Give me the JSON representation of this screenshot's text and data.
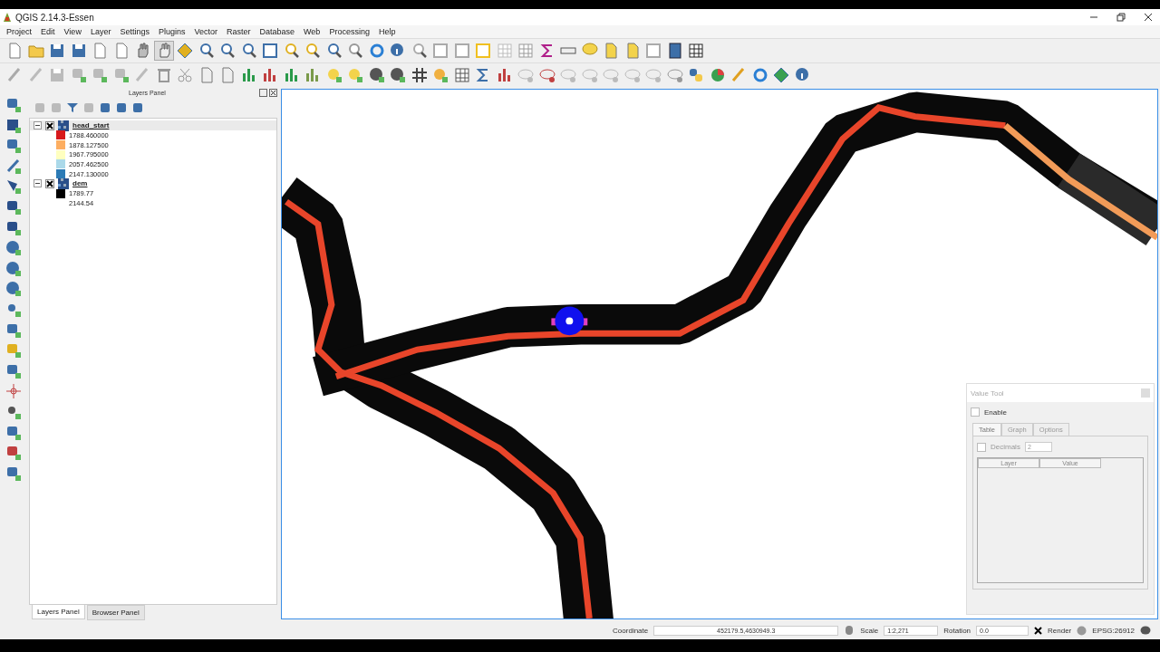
{
  "window": {
    "title": "QGIS 2.14.3-Essen"
  },
  "menu": [
    "Project",
    "Edit",
    "View",
    "Layer",
    "Settings",
    "Plugins",
    "Vector",
    "Raster",
    "Database",
    "Web",
    "Processing",
    "Help"
  ],
  "layers_panel": {
    "title": "Layers Panel",
    "layers": [
      {
        "name": "head_start",
        "checked": true,
        "expanded": true,
        "selected": true,
        "legend": [
          {
            "label": "1788.460000",
            "color": "#d7191c"
          },
          {
            "label": "1878.127500",
            "color": "#fdae61"
          },
          {
            "label": "1967.795000",
            "color": "#ffffbf"
          },
          {
            "label": "2057.462500",
            "color": "#abd9e9"
          },
          {
            "label": "2147.130000",
            "color": "#2c7bb6"
          }
        ]
      },
      {
        "name": "dem",
        "checked": true,
        "expanded": true,
        "selected": false,
        "legend": [
          {
            "label": "1789.77",
            "color": "#000000"
          },
          {
            "label": "2144.54"
          }
        ]
      }
    ]
  },
  "panel_tabs": [
    {
      "label": "Layers Panel",
      "selected": true
    },
    {
      "label": "Browser Panel",
      "selected": false
    }
  ],
  "value_tool": {
    "title": "Value Tool",
    "enable": {
      "label": "Enable",
      "checked": false
    },
    "tabs": [
      {
        "label": "Table",
        "selected": true
      },
      {
        "label": "Graph",
        "selected": false
      },
      {
        "label": "Options",
        "selected": false
      }
    ],
    "decimals": {
      "label": "Decimals",
      "checked": false,
      "value": "2"
    },
    "columns": [
      "Layer",
      "Value"
    ]
  },
  "status_bar": {
    "coordinate_label": "Coordinate",
    "coordinate": "452179.5,4630949.3",
    "scale_label": "Scale",
    "scale": "1:2,271",
    "rotation_label": "Rotation",
    "rotation": "0.0",
    "render": {
      "label": "Render",
      "checked": true
    },
    "crs": "EPSG:26912"
  }
}
